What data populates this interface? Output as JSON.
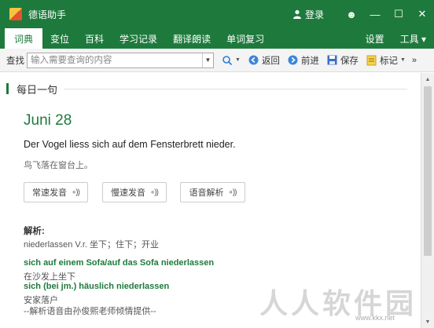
{
  "window": {
    "title": "德语助手",
    "login_label": "登录",
    "buttons": [
      "☻",
      "—",
      "☐",
      "✕"
    ]
  },
  "menu": {
    "tabs": [
      "词典",
      "变位",
      "百科",
      "学习记录",
      "翻译朗读",
      "单词复习"
    ],
    "right": [
      "设置",
      "工具 ▾"
    ]
  },
  "toolbar": {
    "find_label": "查找",
    "search_placeholder": "输入需要查询的内容",
    "back_label": "返回",
    "forward_label": "前进",
    "save_label": "保存",
    "mark_label": "标记",
    "more": "»"
  },
  "daily": {
    "section_title": "每日一句",
    "date": "Juni 28",
    "sentence": "Der Vogel liess sich auf dem Fensterbrett nieder.",
    "translation": "鸟飞落在窗台上。",
    "audio_buttons": [
      "常速发音",
      "慢速发音",
      "语音解析"
    ],
    "wave_icon": "∘))"
  },
  "explanation": {
    "title": "解析:",
    "lines": [
      {
        "text": "niederlassen V.r. 坐下；住下；开业",
        "style": "gray"
      },
      {
        "text": "sich auf einem Sofa/auf das Sofa niederlassen",
        "style": "green"
      },
      {
        "text": "在沙发上坐下",
        "style": "gray"
      },
      {
        "text": "sich (bei jm.) häuslich niederlassen",
        "style": "green"
      },
      {
        "text": "安家落户",
        "style": "gray"
      },
      {
        "text": "--解析语音由孙俊熙老师倾情提供--",
        "style": "gray"
      }
    ]
  },
  "watermark": {
    "text": "人人软件园",
    "url": "www.kkx.net"
  },
  "colors": {
    "brand_green": "#1e7a3c"
  }
}
